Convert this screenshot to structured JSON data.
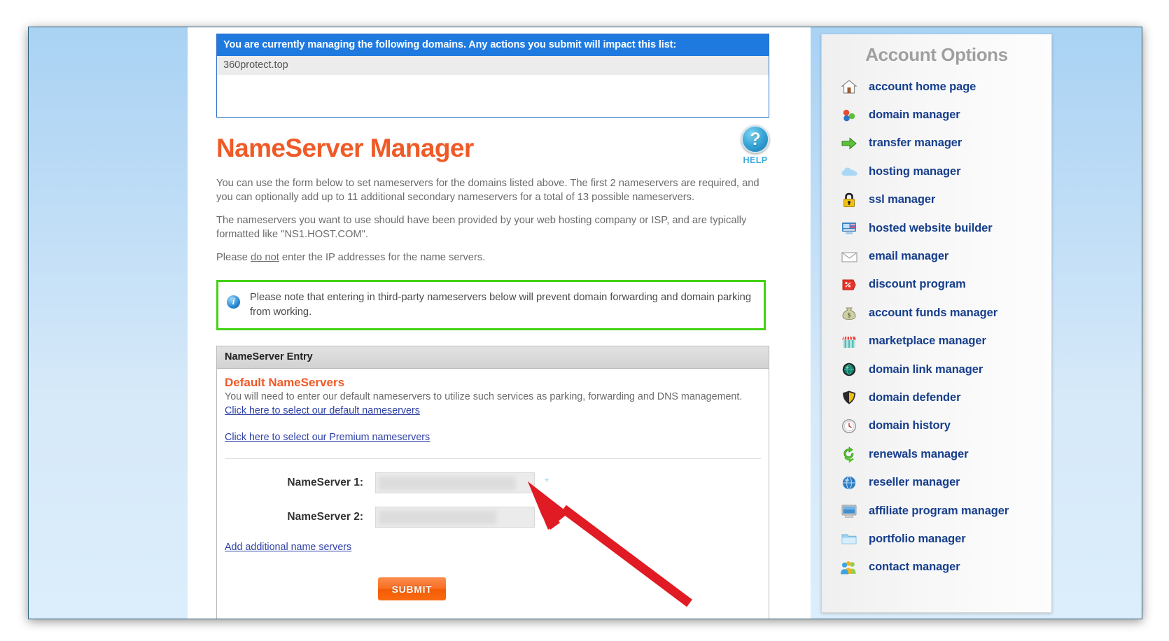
{
  "domain_box": {
    "header": "You are currently managing the following domains. Any actions you submit will impact this list:",
    "domains": [
      "360protect.top"
    ]
  },
  "page": {
    "title": "NameServer Manager",
    "help_icon": "question-mark-icon",
    "help_label": "HELP",
    "paragraphs": [
      "You can use the form below to set nameservers for the domains listed above. The first 2 nameservers are required, and you can optionally add up to 11 additional secondary nameservers for a total of 13 possible nameservers.",
      "The nameservers you want to use should have been provided by your web hosting company or ISP, and are typically formatted like \"NS1.HOST.COM\"."
    ],
    "ip_note_prefix": "Please ",
    "ip_note_emphasis": "do not",
    "ip_note_suffix": " enter the IP addresses for the name servers."
  },
  "notice": {
    "icon": "info-icon",
    "text": "Please note that entering in third-party nameservers below will prevent domain forwarding and domain parking from working.",
    "border_color": "#44d216"
  },
  "ns_panel": {
    "header": "NameServer Entry",
    "subtitle": "Default NameServers",
    "description": "You will need to enter our default nameservers to utilize such services as parking, forwarding and DNS management.",
    "default_link": "Click here to select our default nameservers",
    "premium_link": "Click here to select our Premium nameservers",
    "fields": [
      {
        "label": "NameServer 1:",
        "value": "",
        "placeholder": "",
        "required_marker": "*"
      },
      {
        "label": "NameServer 2:",
        "value": "",
        "placeholder": "",
        "required_marker": "*"
      }
    ],
    "add_link": "Add additional name servers",
    "submit_label": "SUBMIT"
  },
  "sidebar": {
    "title": "Account Options",
    "items": [
      {
        "label": "account home page",
        "icon": "home-icon"
      },
      {
        "label": "domain manager",
        "icon": "domain-nodes-icon"
      },
      {
        "label": "transfer manager",
        "icon": "green-arrow-icon"
      },
      {
        "label": "hosting manager",
        "icon": "cloud-icon"
      },
      {
        "label": "ssl manager",
        "icon": "lock-icon"
      },
      {
        "label": "hosted website builder",
        "icon": "website-builder-icon"
      },
      {
        "label": "email manager",
        "icon": "envelope-icon"
      },
      {
        "label": "discount program",
        "icon": "price-tag-icon"
      },
      {
        "label": "account funds manager",
        "icon": "money-bag-icon"
      },
      {
        "label": "marketplace manager",
        "icon": "storefront-icon"
      },
      {
        "label": "domain link manager",
        "icon": "globe-dark-icon"
      },
      {
        "label": "domain defender",
        "icon": "shield-icon"
      },
      {
        "label": "domain history",
        "icon": "clock-icon"
      },
      {
        "label": "renewals manager",
        "icon": "refresh-icon"
      },
      {
        "label": "reseller manager",
        "icon": "globe-blue-icon"
      },
      {
        "label": "affiliate program manager",
        "icon": "monitor-icon"
      },
      {
        "label": "portfolio manager",
        "icon": "folder-icon"
      },
      {
        "label": "contact manager",
        "icon": "people-icon"
      }
    ]
  },
  "annotation": {
    "type": "red-arrow",
    "color": "#e01b24",
    "points_to": "NameServer 2 required marker"
  }
}
